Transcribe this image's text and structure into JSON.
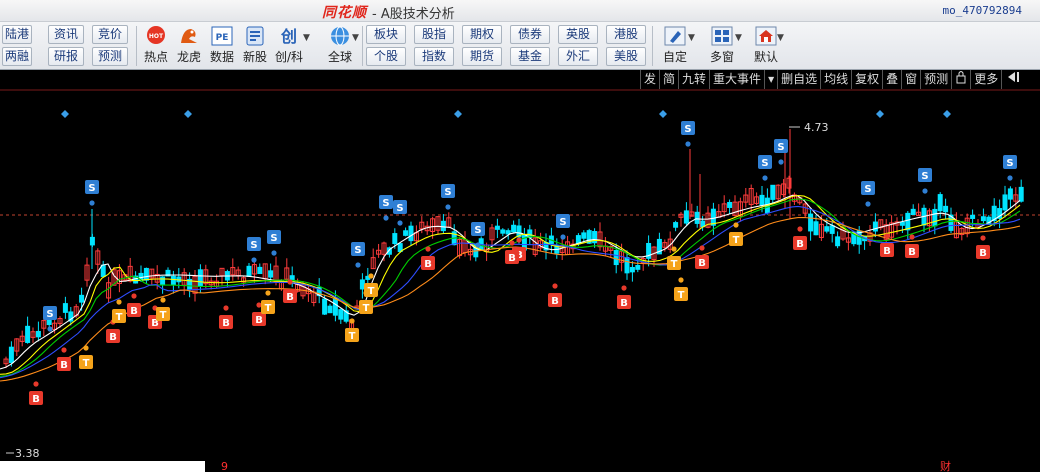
{
  "app": {
    "logo": "同花顺",
    "title": "A股技术分析",
    "title_sep": "-",
    "account": "mo_470792894"
  },
  "toolbar": {
    "nav_buttons": [
      {
        "id": "lugang",
        "label": "陆港"
      },
      {
        "id": "lianglong",
        "label": "两融"
      },
      {
        "id": "zixun",
        "label": "资讯"
      },
      {
        "id": "yanbao",
        "label": "研报"
      },
      {
        "id": "jingjia",
        "label": "竞价"
      },
      {
        "id": "yuce",
        "label": "预测"
      }
    ],
    "icon_buttons": [
      {
        "id": "redian",
        "label": "热点",
        "icon": "hot-icon"
      },
      {
        "id": "longhu",
        "label": "龙虎",
        "icon": "dragon-icon"
      },
      {
        "id": "shuju",
        "label": "数据",
        "icon": "pe-data-icon"
      },
      {
        "id": "xingu",
        "label": "新股",
        "icon": "new-stock-icon"
      },
      {
        "id": "chuangke",
        "label": "创/科",
        "icon": "chuang-icon"
      },
      {
        "id": "quanqiu",
        "label": "全球",
        "icon": "globe-icon"
      }
    ],
    "market_buttons": [
      {
        "id": "bankuai",
        "label": "板块"
      },
      {
        "id": "gegu",
        "label": "个股"
      },
      {
        "id": "guzhi",
        "label": "股指"
      },
      {
        "id": "zhishu",
        "label": "指数"
      },
      {
        "id": "qiquan",
        "label": "期权"
      },
      {
        "id": "qihuo",
        "label": "期货"
      },
      {
        "id": "zhaiquan",
        "label": "债券"
      },
      {
        "id": "jijin",
        "label": "基金"
      },
      {
        "id": "yinggu",
        "label": "英股"
      },
      {
        "id": "waihui",
        "label": "外汇"
      },
      {
        "id": "ganggu",
        "label": "港股"
      },
      {
        "id": "meigu",
        "label": "美股"
      }
    ],
    "right_buttons": [
      {
        "id": "ziding",
        "label": "自定",
        "icon": "edit-icon"
      },
      {
        "id": "duochuang",
        "label": "多窗",
        "icon": "grid-icon"
      },
      {
        "id": "moren",
        "label": "默认",
        "icon": "home-icon"
      }
    ]
  },
  "chart_toolbar": {
    "items": [
      "发",
      "简",
      "九转",
      "重大事件",
      "▾",
      "删自选",
      "均线",
      "复权",
      "叠",
      "窗",
      "预测",
      "更多"
    ]
  },
  "colors": {
    "up": "#ff3c3c",
    "down": "#00e4ff",
    "ma5": "#ffffff",
    "ma10": "#ffff00",
    "ma20": "#00cc00",
    "ma30": "#2e4dff",
    "ma60": "#ff8c1a",
    "buy_badge": "#e8392b",
    "sell_badge": "#2f7fd4",
    "t_badge": "#f5a31a",
    "diamond": "#3a9ee8"
  },
  "chart_data": {
    "type": "candlestick",
    "high_label": "4.73",
    "low_label": "3.38",
    "bottom_markers": [
      "9",
      "财"
    ],
    "badge_letters": {
      "buy": "B",
      "sell": "S",
      "t": "T"
    }
  }
}
